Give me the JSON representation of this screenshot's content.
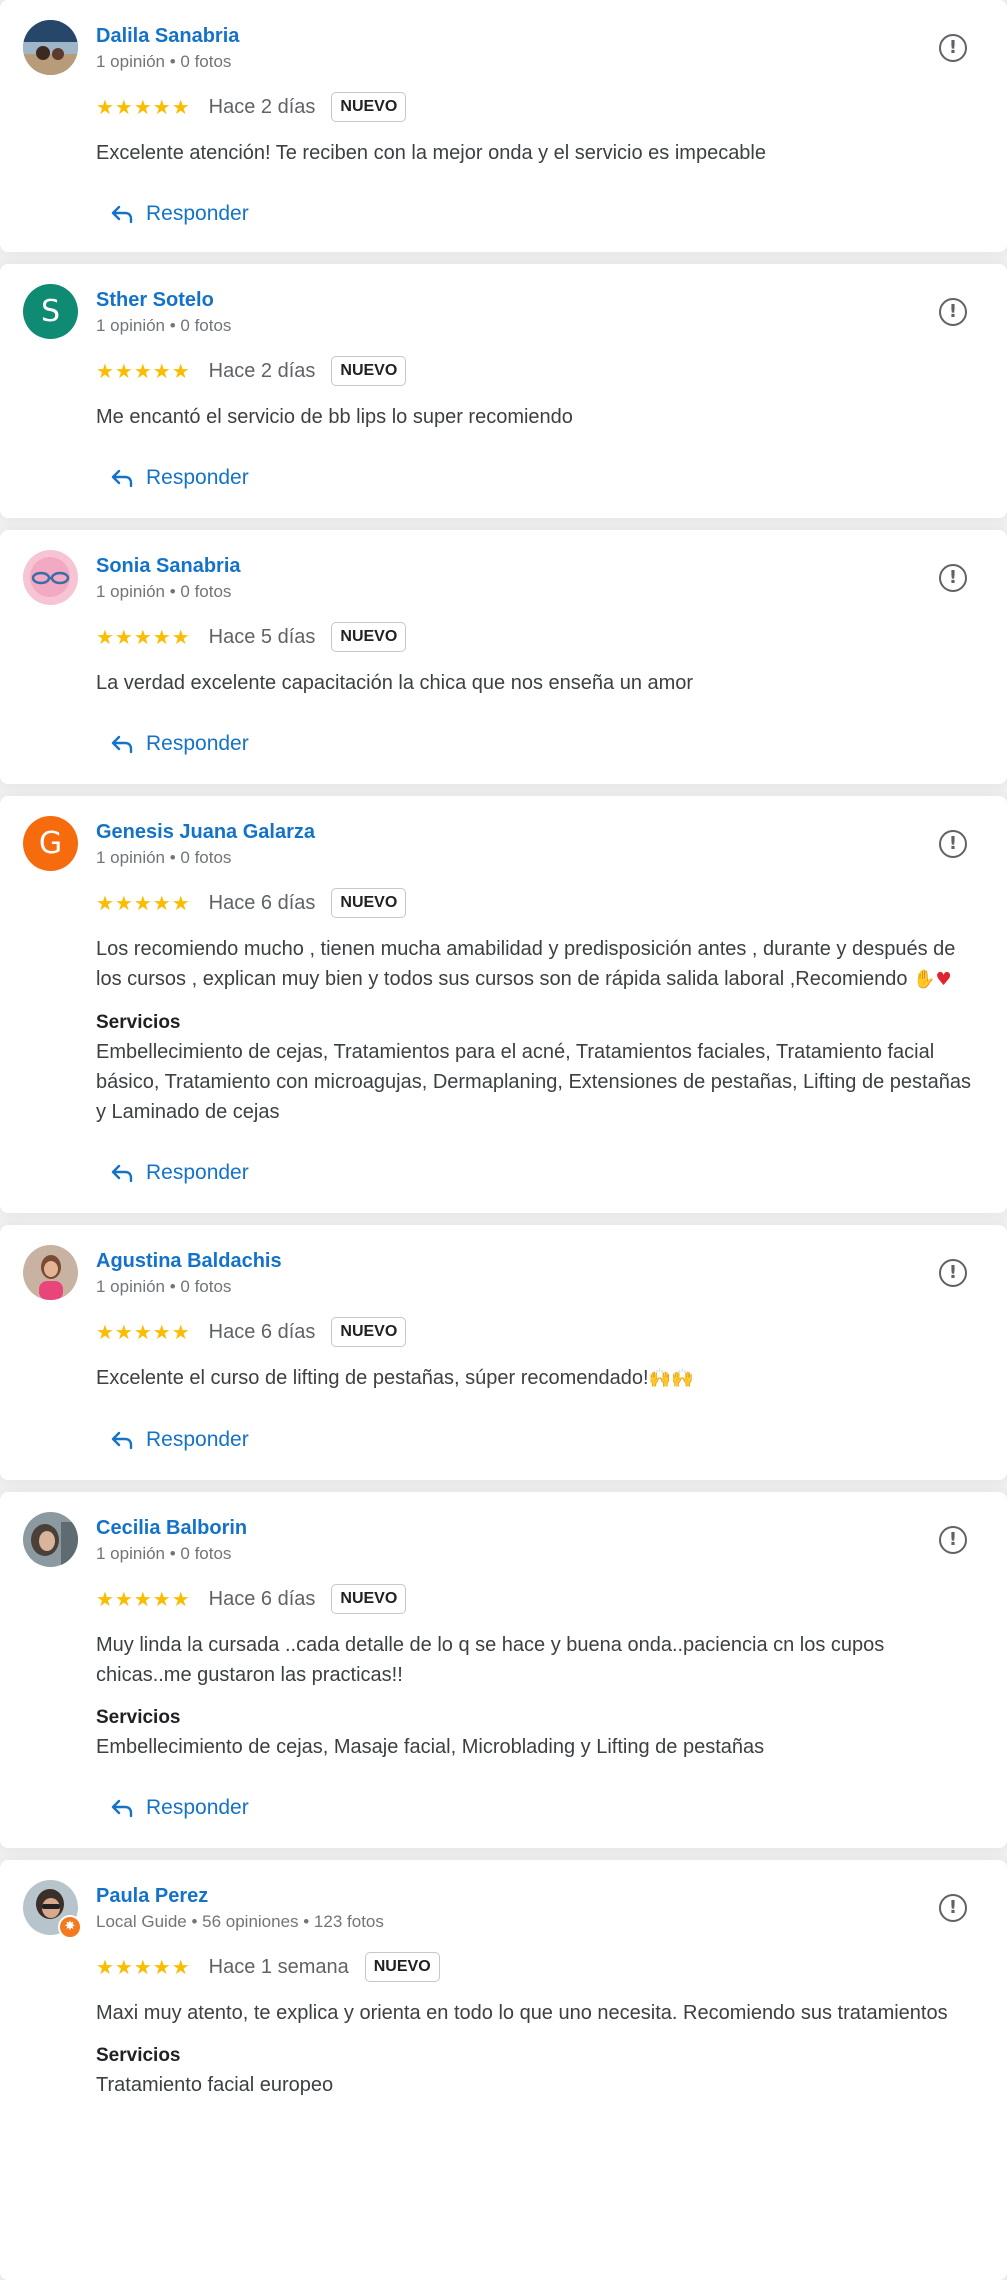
{
  "colors": {
    "link": "#1473c9",
    "star": "#fbbc04",
    "avatar_sther": "#0f8a73",
    "avatar_genesis": "#f66b0e",
    "local_guide": "#f4791f"
  },
  "reviews": [
    {
      "name": "Dalila Sanabria",
      "meta": "1 opinión • 0 fotos",
      "stars": "★★★★★",
      "time": "Hace 2 días",
      "badge": "NUEVO",
      "text": "Excelente atención! Te reciben con la mejor onda y el servicio es impecable",
      "reply": "Responder"
    },
    {
      "name": "Sther Sotelo",
      "initial": "S",
      "meta": "1 opinión • 0 fotos",
      "stars": "★★★★★",
      "time": "Hace 2 días",
      "badge": "NUEVO",
      "text": "Me encantó el servicio de bb lips lo super recomiendo",
      "reply": "Responder"
    },
    {
      "name": "Sonia Sanabria",
      "meta": "1 opinión • 0 fotos",
      "stars": "★★★★★",
      "time": "Hace 5 días",
      "badge": "NUEVO",
      "text": "La verdad excelente capacitación la chica que nos enseña un amor",
      "reply": "Responder"
    },
    {
      "name": "Genesis Juana Galarza",
      "initial": "G",
      "meta": "1 opinión • 0 fotos",
      "stars": "★★★★★",
      "time": "Hace 6 días",
      "badge": "NUEVO",
      "text": "Los recomiendo mucho , tienen mucha amabilidad y predisposición antes , durante y después de los cursos , explican muy bien y todos sus cursos son de rápida salida laboral ,Recomiendo",
      "services_title": "Servicios",
      "services": "Embellecimiento de cejas, Tratamientos para el acné, Tratamientos faciales, Tratamiento facial básico, Tratamiento con microagujas, Dermaplaning, Extensiones de pestañas, Lifting de pestañas y Laminado de cejas",
      "reply": "Responder"
    },
    {
      "name": "Agustina Baldachis",
      "meta": "1 opinión • 0 fotos",
      "stars": "★★★★★",
      "time": "Hace 6 días",
      "badge": "NUEVO",
      "text": "Excelente el curso de lifting de pestañas, súper recomendado!",
      "reply": "Responder"
    },
    {
      "name": "Cecilia Balborin",
      "meta": "1 opinión • 0 fotos",
      "stars": "★★★★★",
      "time": "Hace 6 días",
      "badge": "NUEVO",
      "text": "Muy linda la cursada ..cada detalle de lo q se hace y buena onda..paciencia cn los cupos chicas..me gustaron las practicas!!",
      "services_title": "Servicios",
      "services": "Embellecimiento de cejas, Masaje facial, Microblading y Lifting de pestañas",
      "reply": "Responder"
    },
    {
      "name": "Paula Perez",
      "meta": "Local Guide • 56 opiniones • 123 fotos",
      "stars": "★★★★★",
      "time": "Hace 1 semana",
      "badge": "NUEVO",
      "text": "Maxi muy atento, te explica y orienta en todo lo que uno necesita. Recomiendo sus tratamientos",
      "services_title": "Servicios",
      "services": "Tratamiento facial europeo"
    }
  ]
}
